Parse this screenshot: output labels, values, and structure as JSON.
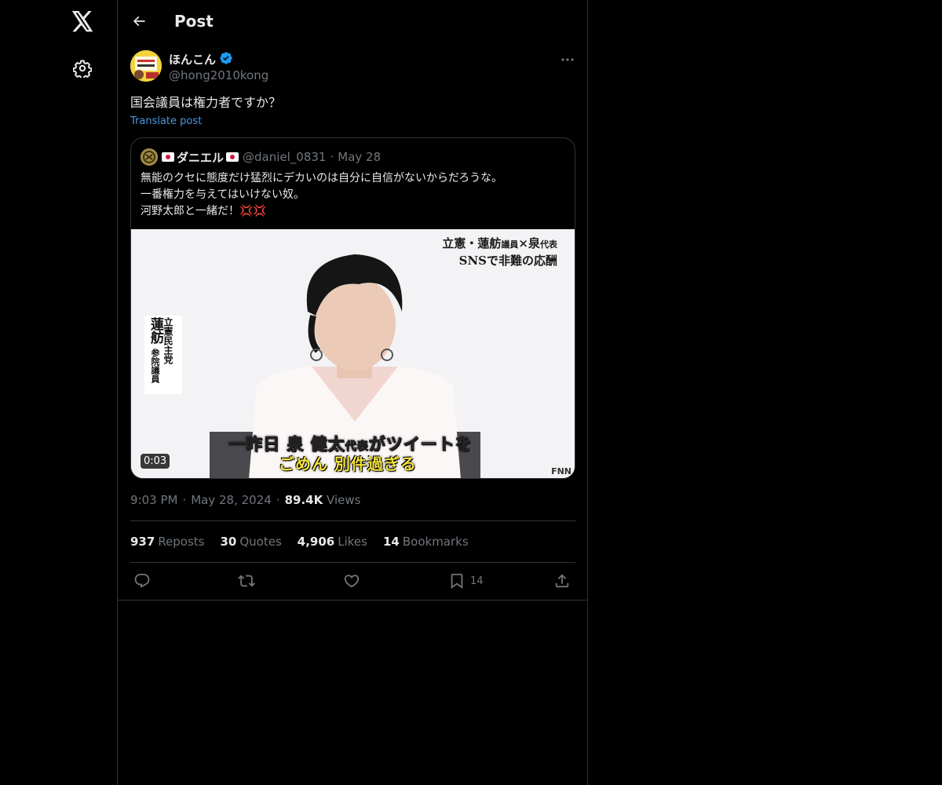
{
  "header": {
    "title": "Post",
    "back_icon": "arrow-left-icon"
  },
  "sidenav": {
    "logo_icon": "x-logo-icon",
    "settings_icon": "gear-icon"
  },
  "post": {
    "author": {
      "display_name": "ほんこん",
      "handle": "@hong2010kong",
      "verified": true,
      "verified_color": "#1d9bf0"
    },
    "text": "国会議員は権力者ですか？",
    "translate_label": "Translate post",
    "time": "9:03 PM",
    "date": "May 28, 2024",
    "views_count": "89.4K",
    "views_label": "Views",
    "sep": "·"
  },
  "quote": {
    "display_name": "ダニエル",
    "handle": "@daniel_0831",
    "date": "May 28",
    "sep": "·",
    "lines": [
      "無能のクセに態度だけ猛烈にデカいのは自分に自信がないからだろうな。",
      "一番権力を与えてはいけない奴。",
      "河野太郎と一緒だ！"
    ],
    "emoji": "💢💢",
    "video": {
      "duration": "0:03",
      "caption_top_line1_a": "立憲・蓮舫",
      "caption_top_line1_small": "議員",
      "caption_top_line1_b": "×泉",
      "caption_top_line1_small2": "代表",
      "caption_top_line2": "SNSで非難の応酬",
      "name_party": "立憲民主党",
      "name_person": "蓮舫",
      "name_title": "参院議員",
      "subtitle_1_a": "一昨日 泉 健太",
      "subtitle_1_small": "代表",
      "subtitle_1_b": "がツイートを",
      "subtitle_2": "ごめん 別件過ぎる",
      "watermark": "FNN"
    }
  },
  "stats": [
    {
      "count": "937",
      "label": "Reposts"
    },
    {
      "count": "30",
      "label": "Quotes"
    },
    {
      "count": "4,906",
      "label": "Likes"
    },
    {
      "count": "14",
      "label": "Bookmarks"
    }
  ],
  "actions": {
    "reply_icon": "reply-icon",
    "repost_icon": "repost-icon",
    "like_icon": "heart-icon",
    "bookmark_icon": "bookmark-icon",
    "bookmark_count": "14",
    "share_icon": "share-icon"
  },
  "colors": {
    "background": "#000000",
    "text": "#e7e9ea",
    "muted": "#71767b",
    "border": "#2f3336",
    "link": "#4f95e0"
  }
}
